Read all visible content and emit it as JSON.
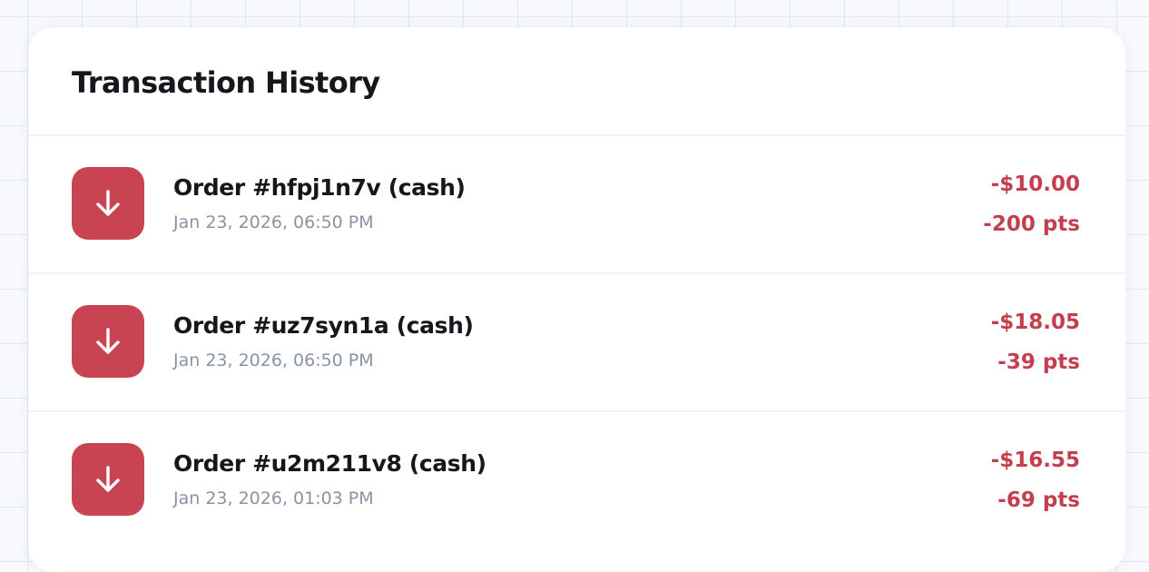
{
  "colors": {
    "accent": "#c94453",
    "negative_text": "#c43f4e",
    "title_text": "#16161c",
    "muted_text": "#8a93a4"
  },
  "card": {
    "title": "Transaction History"
  },
  "transactions": [
    {
      "icon": "arrow-down-icon",
      "title": "Order #hfpj1n7v (cash)",
      "date": "Jan 23, 2026, 06:50 PM",
      "amount": "-$10.00",
      "points": "-200 pts"
    },
    {
      "icon": "arrow-down-icon",
      "title": "Order #uz7syn1a (cash)",
      "date": "Jan 23, 2026, 06:50 PM",
      "amount": "-$18.05",
      "points": "-39 pts"
    },
    {
      "icon": "arrow-down-icon",
      "title": "Order #u2m211v8 (cash)",
      "date": "Jan 23, 2026, 01:03 PM",
      "amount": "-$16.55",
      "points": "-69 pts"
    }
  ]
}
